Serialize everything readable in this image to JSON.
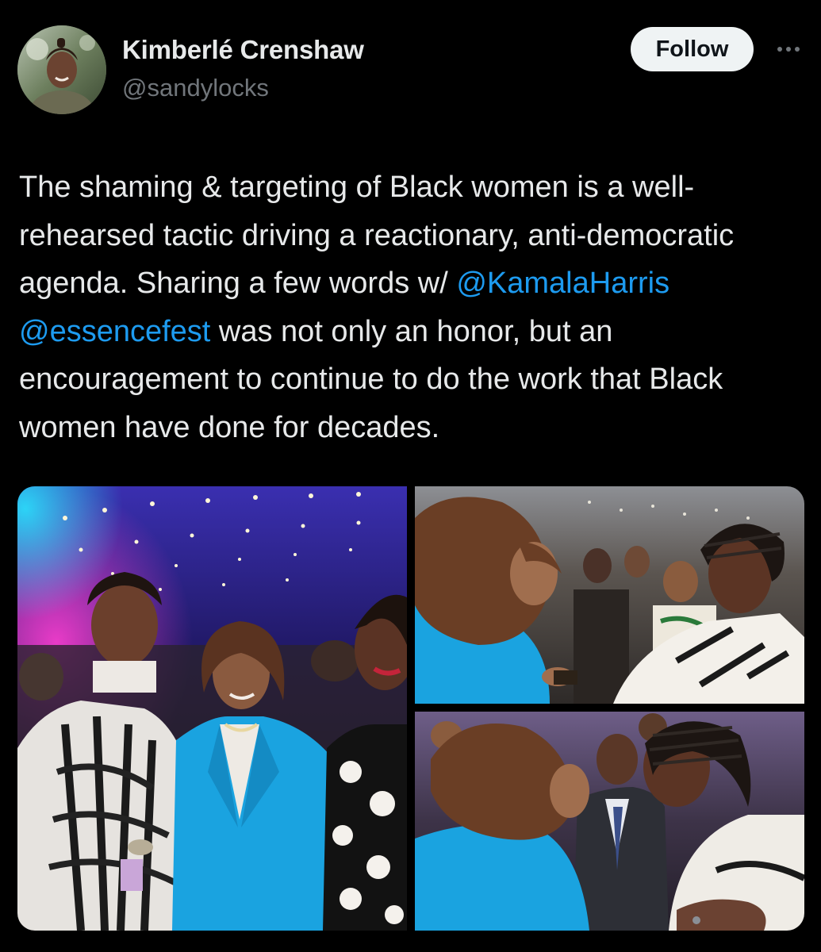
{
  "author": {
    "name": "Kimberlé Crenshaw",
    "handle": "@sandylocks"
  },
  "follow_label": "Follow",
  "more_icon": "more-horizontal-icon",
  "tweet": {
    "text_before_mentions": "The shaming & targeting of Black women is a well-rehearsed tactic driving a reactionary, anti-democratic agenda. Sharing a few words w/ ",
    "mention_1": "@KamalaHarris",
    "mention_2": "@essencefest",
    "text_after_mentions": " was not only an honor, but an encouragement to continue to do the work that Black women have done for decades."
  },
  "colors": {
    "background": "#000000",
    "text": "#e7e9ea",
    "secondary_text": "#71767b",
    "link": "#1d9bf0",
    "follow_bg": "#eff3f4",
    "blazer_blue": "#1aa3e0"
  },
  "media": {
    "count": 3
  }
}
